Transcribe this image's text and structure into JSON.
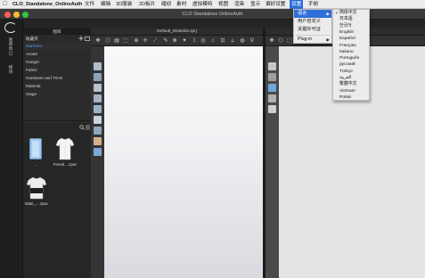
{
  "menubar": {
    "app_name": "CLO_Standalone_OnlineAuth",
    "items": [
      "文件",
      "编辑",
      "3D服装",
      "2D板片",
      "缝纫",
      "素材",
      "虚拟模特",
      "视图",
      "渲染",
      "显示",
      "偏好设置",
      "设置",
      "手册"
    ],
    "active_item": "设置"
  },
  "window": {
    "title": "CLO Standalone OnlineAuth"
  },
  "sidebar": {
    "vertical_labels": [
      "图库窗口",
      "模块"
    ]
  },
  "library": {
    "header": "图库",
    "items": [
      {
        "label": "收藏夹",
        "selected": false
      },
      {
        "label": "Garment",
        "selected": true
      },
      {
        "label": "Avatar",
        "selected": false
      },
      {
        "label": "Hanger",
        "selected": false
      },
      {
        "label": "Fabric",
        "selected": false
      },
      {
        "label": "Hardware and Trims",
        "selected": false
      },
      {
        "label": "Material",
        "selected": false
      },
      {
        "label": "Stage",
        "selected": false
      }
    ],
    "thumbnails": [
      {
        "label": "..",
        "icon": "folder-icon"
      },
      {
        "label": "Femal....zpac",
        "icon": "garment-icon"
      },
      {
        "label": "Male_....zpac",
        "icon": "garment-icon"
      }
    ]
  },
  "viewport3d": {
    "tab_title": "Default_Modelist.zprj"
  },
  "settings_menu": {
    "items": [
      "语言",
      "用户自定义",
      "关键许可证",
      "Plug-in"
    ],
    "highlighted": "语言"
  },
  "language_menu": {
    "items": [
      "简体中文",
      "日本語",
      "한국어",
      "English",
      "Español",
      "Français",
      "Italiano",
      "Português",
      "русский",
      "Türkçe",
      "العربية",
      "繁體中文",
      "Vietnam",
      "Polski"
    ],
    "checked": "简体中文"
  },
  "colors": {
    "accent": "#2f6fd8",
    "selected_text": "#4ea2ff",
    "panel_dark": "#2b2b2b"
  }
}
